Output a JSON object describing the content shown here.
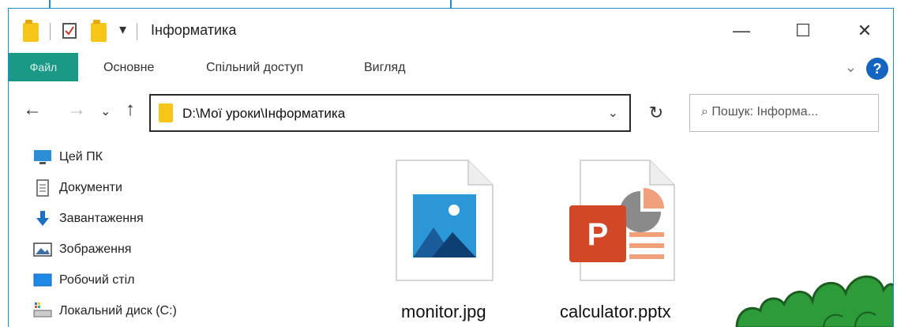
{
  "window": {
    "title": "Інформатика",
    "qa_arrow": "▾",
    "controls": {
      "minimize": "—",
      "maximize": "☐",
      "close": "✕"
    }
  },
  "ribbon": {
    "file": "Файл",
    "tabs": [
      "Основне",
      "Спільний доступ",
      "Вигляд"
    ],
    "collapse": "⌄",
    "help": "?"
  },
  "nav": {
    "back": "←",
    "forward": "→",
    "recent": "⌄",
    "up": "↑",
    "address": "D:\\Мої уроки\\Інформатика",
    "address_dropdown": "⌄",
    "refresh": "↻",
    "search_placeholder": "Пошук: Інформа...",
    "search_icon": "⌕"
  },
  "sidebar": {
    "items": [
      {
        "label": "Цей ПК",
        "icon": "computer-icon"
      },
      {
        "label": "Документи",
        "icon": "documents-icon"
      },
      {
        "label": "Завантаження",
        "icon": "downloads-icon"
      },
      {
        "label": "Зображення",
        "icon": "pictures-icon"
      },
      {
        "label": "Робочий стіл",
        "icon": "desktop-icon"
      },
      {
        "label": "Локальний диск (C:)",
        "icon": "local-disk-icon"
      }
    ]
  },
  "files": [
    {
      "name": "monitor.jpg",
      "icon": "image-file-icon"
    },
    {
      "name": "calculator.pptx",
      "icon": "powerpoint-file-icon"
    }
  ],
  "colors": {
    "file_tab": "#1a9a86",
    "accent": "#1f8fc7",
    "folder": "#f5c518",
    "powerpoint": "#d24726"
  }
}
